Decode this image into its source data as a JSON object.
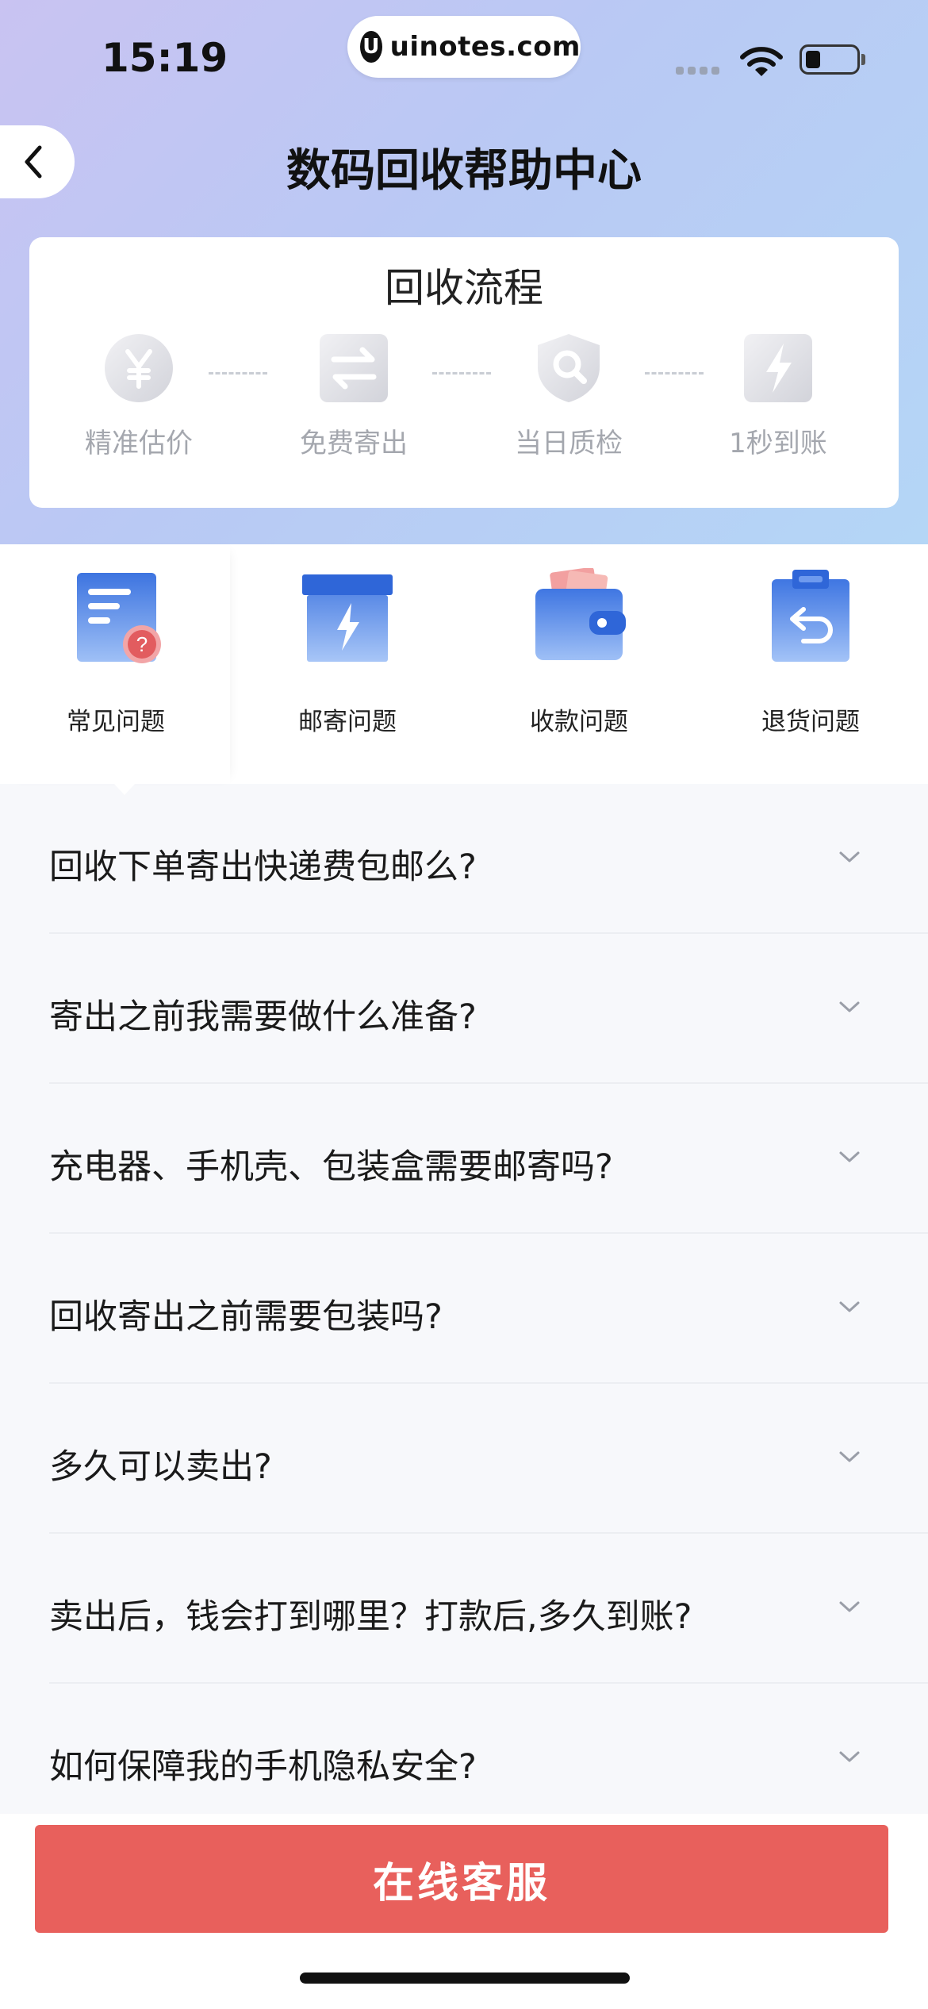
{
  "status_bar": {
    "time": "15:19",
    "watermark": "uinotes.com",
    "watermark_logo": "U"
  },
  "nav": {
    "title": "数码回收帮助中心",
    "back_icon": "chevron-left-icon"
  },
  "process": {
    "title": "回收流程",
    "steps": [
      {
        "label": "精准估价",
        "icon": "yen-coin-icon"
      },
      {
        "label": "免费寄出",
        "icon": "exchange-arrows-icon"
      },
      {
        "label": "当日质检",
        "icon": "shield-search-icon"
      },
      {
        "label": "1秒到账",
        "icon": "lightning-icon"
      }
    ]
  },
  "categories": {
    "active_index": 0,
    "items": [
      {
        "label": "常见问题",
        "icon": "document-question-icon"
      },
      {
        "label": "邮寄问题",
        "icon": "box-lightning-icon"
      },
      {
        "label": "收款问题",
        "icon": "wallet-icon"
      },
      {
        "label": "退货问题",
        "icon": "return-clipboard-icon"
      }
    ]
  },
  "faq": [
    {
      "question": "回收下单寄出快递费包邮么?"
    },
    {
      "question": "寄出之前我需要做什么准备?"
    },
    {
      "question": "充电器、手机壳、包装盒需要邮寄吗?"
    },
    {
      "question": "回收寄出之前需要包装吗?"
    },
    {
      "question": "多久可以卖出?"
    },
    {
      "question": "卖出后，钱会打到哪里？打款后,多久到账?"
    },
    {
      "question": "如何保障我的手机隐私安全?"
    }
  ],
  "footer": {
    "service_button": "在线客服"
  },
  "colors": {
    "accent": "#e8605c",
    "icon_blue": "#4a82e8"
  }
}
